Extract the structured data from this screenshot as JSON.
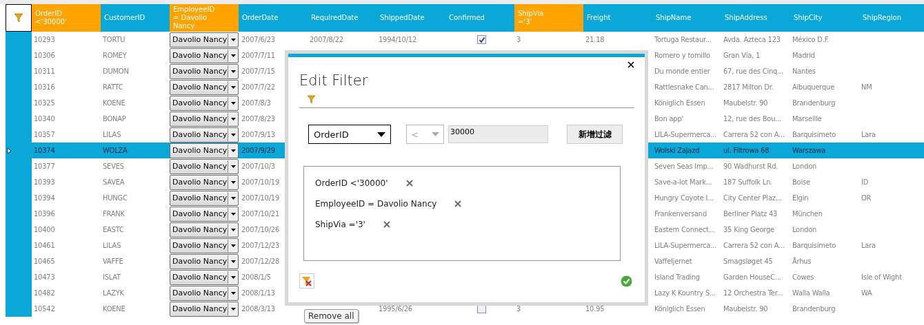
{
  "table": {
    "columns": [
      {
        "label": "OrderID\n<'30000'",
        "filtered": true
      },
      {
        "label": "CustomerID",
        "filtered": false
      },
      {
        "label": "EmployeeID\n= Davolio\nNancy",
        "filtered": true
      },
      {
        "label": "OrderDate",
        "filtered": false
      },
      {
        "label": "RequiredDate",
        "filtered": false
      },
      {
        "label": "ShippedDate",
        "filtered": false
      },
      {
        "label": "Confirmed",
        "filtered": false
      },
      {
        "label": "ShipVia\n='3'",
        "filtered": true
      },
      {
        "label": "Freight",
        "filtered": false
      },
      {
        "label": "ShipName",
        "filtered": false
      },
      {
        "label": "ShipAddress",
        "filtered": false
      },
      {
        "label": "ShipCity",
        "filtered": false
      },
      {
        "label": "ShipRegion",
        "filtered": false
      }
    ],
    "rows": [
      {
        "selected": false,
        "order_id": "10293",
        "customer_id": "TORTU",
        "employee": "Davolio Nancy",
        "order_date": "2007/6/23",
        "required_date": "2007/8/22",
        "shipped_date": "1994/10/12",
        "confirmed": true,
        "ship_via": "3",
        "freight": "21.18",
        "ship_name": "Tortuga Restaur...",
        "ship_address": "Avda. Azteca 123",
        "ship_city": "México D.F."
      },
      {
        "selected": false,
        "order_id": "10306",
        "customer_id": "ROMEY",
        "employee": "Davolio Nancy",
        "order_date": "2007/7/11",
        "ship_name": "Romero y tomillo",
        "ship_address": "Gran Vía, 1",
        "ship_city": "Madrid"
      },
      {
        "selected": false,
        "order_id": "10311",
        "customer_id": "DUMON",
        "employee": "Davolio Nancy",
        "order_date": "2007/7/15",
        "ship_name": "Du monde entier",
        "ship_address": "67, rue des Cinq...",
        "ship_city": "Nantes"
      },
      {
        "selected": false,
        "order_id": "10316",
        "customer_id": "RATTC",
        "employee": "Davolio Nancy",
        "order_date": "2007/7/22",
        "ship_name": "Rattlesnake Can...",
        "ship_address": "2817 Milton Dr.",
        "ship_city": "Albuquerque",
        "ship_region": "NM"
      },
      {
        "selected": false,
        "order_id": "10325",
        "customer_id": "KOENE",
        "employee": "Davolio Nancy",
        "order_date": "2007/8/3",
        "ship_name": "Königlich Essen",
        "ship_address": "Maubelstr. 90",
        "ship_city": "Brandenburg"
      },
      {
        "selected": false,
        "order_id": "10340",
        "customer_id": "BONAP",
        "employee": "Davolio Nancy",
        "order_date": "2007/8/23",
        "ship_name": "Bon app'",
        "ship_address": "12, rue des Bou...",
        "ship_city": "Marseille"
      },
      {
        "selected": false,
        "order_id": "10357",
        "customer_id": "LILAS",
        "employee": "Davolio Nancy",
        "order_date": "2007/9/13",
        "ship_name": "LILA-Supermerca...",
        "ship_address": "Carrera 52 con A...",
        "ship_city": "Barquisimeto",
        "ship_region": "Lara"
      },
      {
        "selected": true,
        "order_id": "10374",
        "customer_id": "WOLZA",
        "employee": "Davolio Nancy",
        "order_date": "2007/9/29",
        "ship_name": "Wolski Zajazd",
        "ship_address": "ul. Filtrowa 68",
        "ship_city": "Warszawa"
      },
      {
        "selected": false,
        "order_id": "10377",
        "customer_id": "SEVES",
        "employee": "Davolio Nancy",
        "order_date": "2007/10/3",
        "ship_name": "Seven Seas Imp...",
        "ship_address": "90 Wadhurst Rd.",
        "ship_city": "London"
      },
      {
        "selected": false,
        "order_id": "10393",
        "customer_id": "SAVEA",
        "employee": "Davolio Nancy",
        "order_date": "2007/10/19",
        "ship_name": "Save-a-lot Mark...",
        "ship_address": "187 Suffolk Ln.",
        "ship_city": "Boise",
        "ship_region": "ID"
      },
      {
        "selected": false,
        "order_id": "10394",
        "customer_id": "HUNGC",
        "employee": "Davolio Nancy",
        "order_date": "2007/10/19",
        "ship_name": "Hungry Coyote I...",
        "ship_address": "City Center Plaz...",
        "ship_city": "Elgin",
        "ship_region": "OR"
      },
      {
        "selected": false,
        "order_id": "10396",
        "customer_id": "FRANK",
        "employee": "Davolio Nancy",
        "order_date": "2007/10/21",
        "ship_name": "Frankenversand",
        "ship_address": "Berliner Platz 43",
        "ship_city": "München"
      },
      {
        "selected": false,
        "order_id": "10400",
        "customer_id": "EASTC",
        "employee": "Davolio Nancy",
        "order_date": "2007/10/26",
        "ship_name": "Eastern Connect...",
        "ship_address": "35 King George",
        "ship_city": "London"
      },
      {
        "selected": false,
        "order_id": "10461",
        "customer_id": "LILAS",
        "employee": "Davolio Nancy",
        "order_date": "2007/12/23",
        "ship_name": "LILA-Supermerca...",
        "ship_address": "Carrera 52 con A...",
        "ship_city": "Barquisimeto",
        "ship_region": "Lara"
      },
      {
        "selected": false,
        "order_id": "10465",
        "customer_id": "VAFFE",
        "employee": "Davolio Nancy",
        "order_date": "2007/12/28",
        "ship_name": "Vaffeljernet",
        "ship_address": "Smagsløget 45",
        "ship_city": "Århus"
      },
      {
        "selected": false,
        "order_id": "10473",
        "customer_id": "ISLAT",
        "employee": "Davolio Nancy",
        "order_date": "2008/1/5",
        "ship_name": "Island Trading",
        "ship_address": "Garden HouseC...",
        "ship_city": "Cowes",
        "ship_region": "Isle of Wight"
      },
      {
        "selected": false,
        "order_id": "10482",
        "customer_id": "LAZYK",
        "employee": "Davolio Nancy",
        "order_date": "2008/1/13",
        "ship_name": "Lazy K Kountry S...",
        "ship_address": "12 Orchestra Ter...",
        "ship_city": "Walla Walla",
        "ship_region": "WA"
      },
      {
        "selected": false,
        "order_id": "10542",
        "customer_id": "KOENE",
        "employee": "Davolio Nancy",
        "order_date": "2008/3/13",
        "shipped_date": "1995/6/26",
        "confirmed": false,
        "ship_via": "3",
        "freight": "10.95",
        "ship_name": "Königlich Essen",
        "ship_address": "Maubelstr. 90",
        "ship_city": "Brandenburg"
      }
    ]
  },
  "dialog": {
    "title": "Edit Filter",
    "field": "OrderID",
    "operator": {
      "value": "<",
      "disabled": true
    },
    "value": "30000",
    "add_button": "新增过滤",
    "filters": [
      {
        "text": "OrderID <'30000'"
      },
      {
        "text": "EmployeeID = Davolio Nancy"
      },
      {
        "text": "ShipVia ='3'"
      }
    ],
    "tooltip": "Remove all"
  }
}
